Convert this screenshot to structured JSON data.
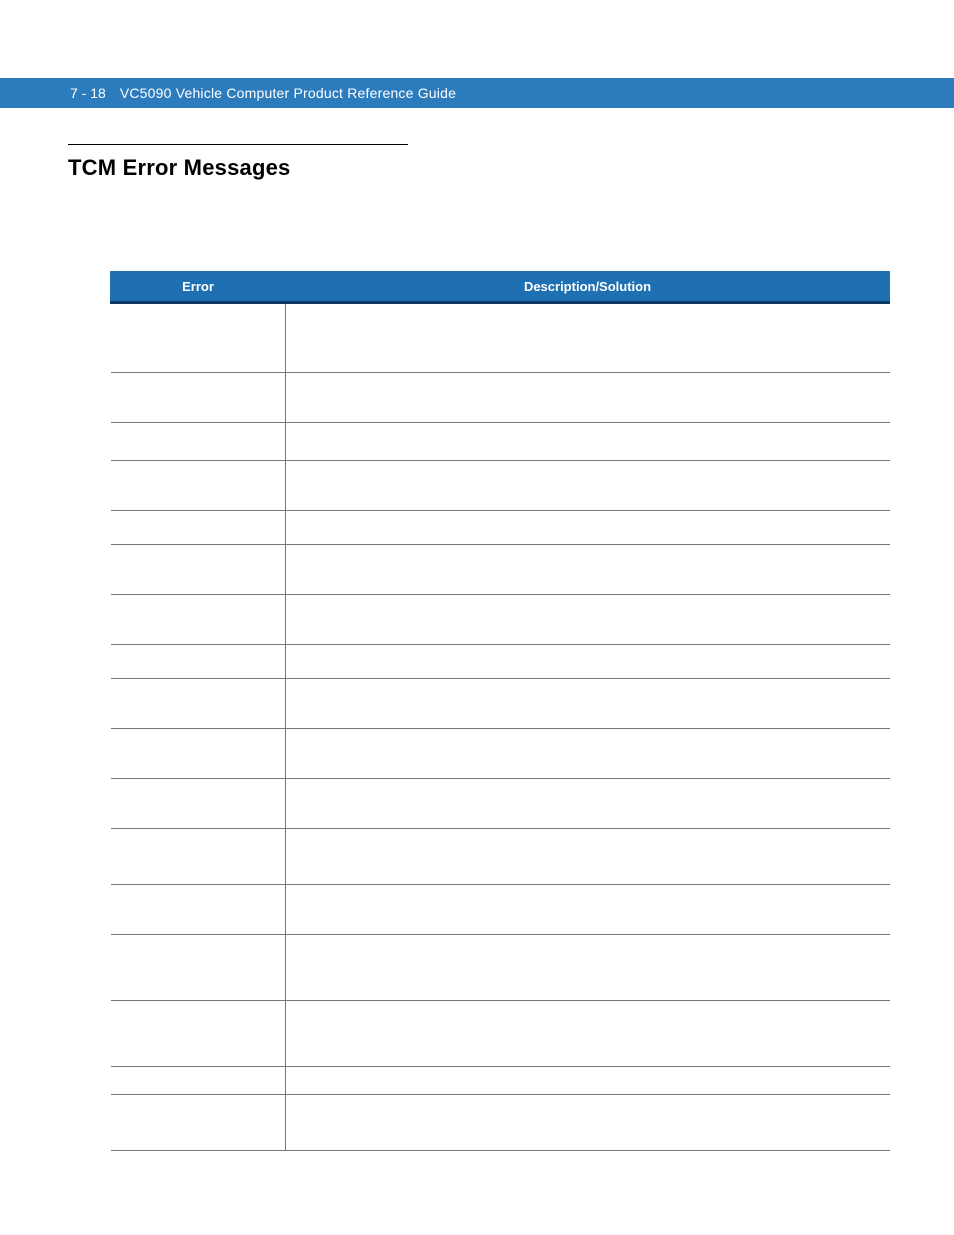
{
  "header": {
    "page_id": "7 - 18",
    "doc_title": "VC5090 Vehicle Computer Product Reference Guide"
  },
  "section": {
    "heading": "TCM Error Messages"
  },
  "table": {
    "columns": [
      "Error",
      "Description/Solution"
    ],
    "rows": [
      {
        "h": "h-lg",
        "error": "",
        "desc": ""
      },
      {
        "h": "h-md",
        "error": "",
        "desc": ""
      },
      {
        "h": "h-sml",
        "error": "",
        "desc": ""
      },
      {
        "h": "h-md",
        "error": "",
        "desc": ""
      },
      {
        "h": "h-sm",
        "error": "",
        "desc": ""
      },
      {
        "h": "h-md",
        "error": "",
        "desc": ""
      },
      {
        "h": "h-md",
        "error": "",
        "desc": ""
      },
      {
        "h": "h-sm",
        "error": "",
        "desc": ""
      },
      {
        "h": "h-md",
        "error": "",
        "desc": ""
      },
      {
        "h": "h-md",
        "error": "",
        "desc": ""
      },
      {
        "h": "h-md",
        "error": "",
        "desc": ""
      },
      {
        "h": "h-mdl",
        "error": "",
        "desc": ""
      },
      {
        "h": "h-md",
        "error": "",
        "desc": ""
      },
      {
        "h": "h-xl",
        "error": "",
        "desc": ""
      },
      {
        "h": "h-xl",
        "error": "",
        "desc": ""
      },
      {
        "h": "h-xs",
        "error": "",
        "desc": ""
      },
      {
        "h": "h-mdl",
        "error": "",
        "desc": ""
      }
    ]
  }
}
